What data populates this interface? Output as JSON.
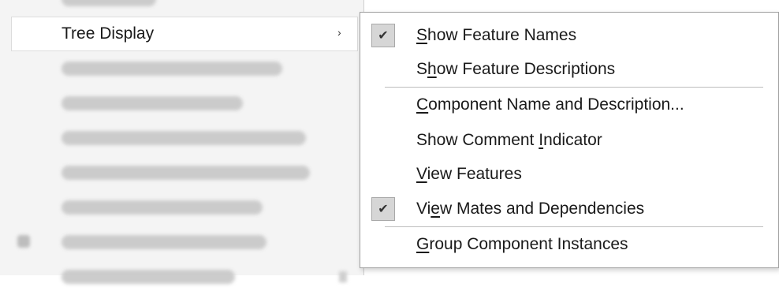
{
  "parent_menu": {
    "tree_display_label": "Tree Display",
    "submenu_arrow": "›"
  },
  "submenu": {
    "check_glyph": "✔",
    "items": [
      {
        "pre": "",
        "u": "S",
        "post": "how Feature Names",
        "checked": true
      },
      {
        "pre": "S",
        "u": "h",
        "post": "ow Feature Descriptions",
        "checked": false
      },
      {
        "pre": "",
        "u": "C",
        "post": "omponent Name and Description...",
        "checked": false
      },
      {
        "pre": "Show Comment ",
        "u": "I",
        "post": "ndicator",
        "checked": false
      },
      {
        "pre": "",
        "u": "V",
        "post": "iew Features",
        "checked": false
      },
      {
        "pre": "Vi",
        "u": "e",
        "post": "w Mates and Dependencies",
        "checked": true
      },
      {
        "pre": "",
        "u": "G",
        "post": "roup Component Instances",
        "checked": false
      }
    ]
  }
}
